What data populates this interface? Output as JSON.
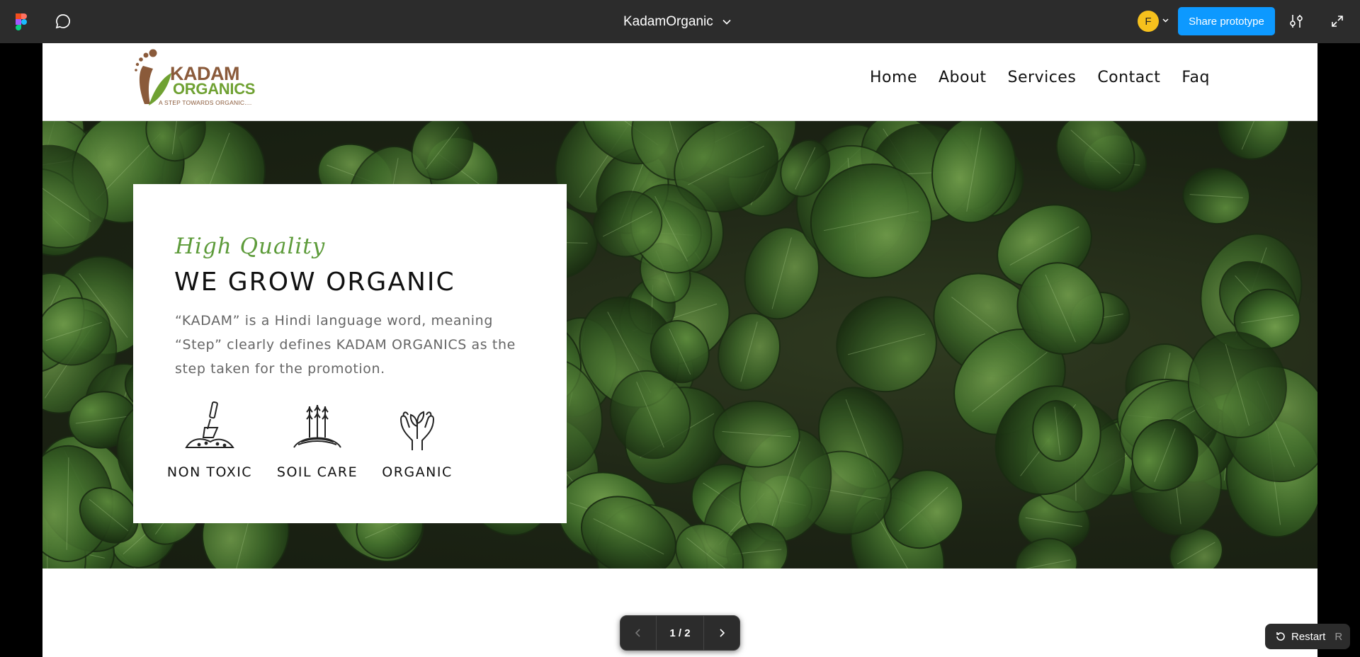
{
  "toolbar": {
    "file_title": "KadamOrganic",
    "avatar_initial": "F",
    "share_label": "Share prototype",
    "share_color": "#0d99ff",
    "avatar_color": "#f6c11d"
  },
  "site": {
    "logo": {
      "line1": "KADAM",
      "line2": "ORGANICS",
      "tagline": "A STEP TOWARDS ORGANIC....",
      "brown": "#8a5a3a",
      "green": "#6fa132"
    },
    "nav": [
      "Home",
      "About",
      "Services",
      "Contact",
      "Faq"
    ]
  },
  "hero": {
    "kicker": "High Quality",
    "title": "WE GROW ORGANIC",
    "description": "“KADAM” is a Hindi language word, meaning “Step” clearly defines KADAM ORGANICS as the step taken for the promotion.",
    "features": [
      {
        "label": "NON TOXIC",
        "icon": "shovel-soil-icon"
      },
      {
        "label": "SOIL CARE",
        "icon": "wheat-field-icon"
      },
      {
        "label": "ORGANIC",
        "icon": "hands-sprout-icon"
      }
    ]
  },
  "prototype_controls": {
    "page_indicator": "1 / 2",
    "restart_label": "Restart",
    "restart_shortcut": "R"
  }
}
